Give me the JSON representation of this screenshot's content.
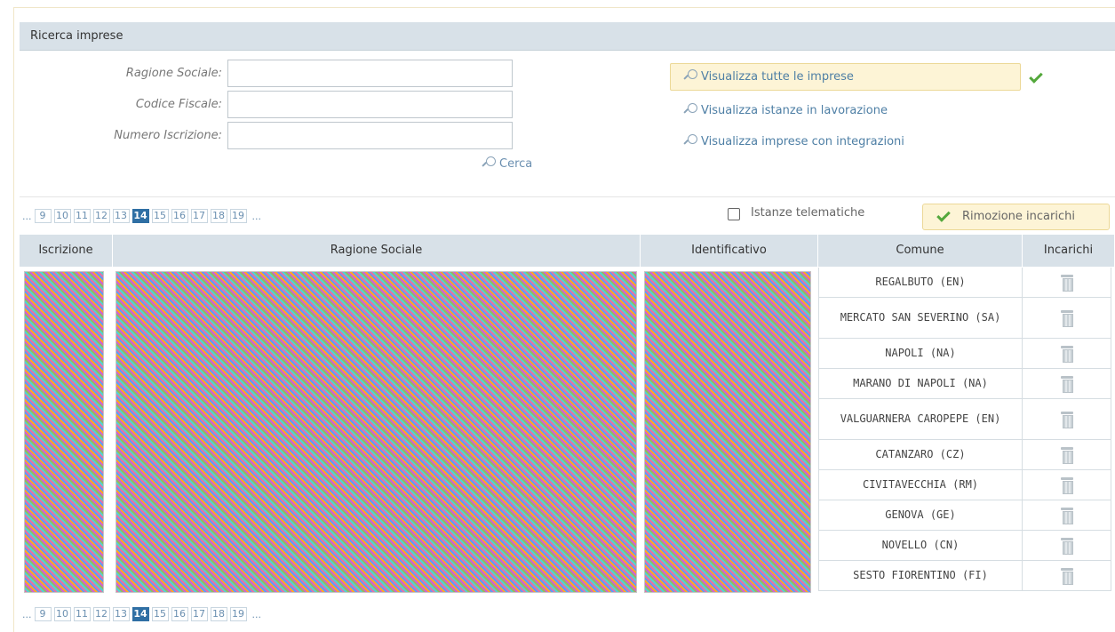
{
  "panel": {
    "title": "Ricerca imprese"
  },
  "form": {
    "ragione_label": "Ragione Sociale:",
    "codice_label": "Codice Fiscale:",
    "numero_label": "Numero Iscrizione:",
    "ragione_value": "",
    "codice_value": "",
    "numero_value": "",
    "search_label": "Cerca"
  },
  "views": {
    "all": "Visualizza tutte le imprese",
    "in_progress": "Visualizza istanze in lavorazione",
    "integrations": "Visualizza imprese con integrazioni"
  },
  "pager": {
    "prefix": "...",
    "suffix": "...",
    "pages": [
      "9",
      "10",
      "11",
      "12",
      "13",
      "14",
      "15",
      "16",
      "17",
      "18",
      "19"
    ],
    "current": "14"
  },
  "toolbar": {
    "telematiche_label": "Istanze telematiche",
    "rimozione_label": "Rimozione incarichi"
  },
  "table": {
    "headers": {
      "iscrizione": "Iscrizione",
      "ragione": "Ragione Sociale",
      "identificativo": "Identificativo",
      "comune": "Comune",
      "incarichi": "Incarichi"
    },
    "rows": [
      {
        "comune": "REGALBUTO (EN)"
      },
      {
        "comune": "MERCATO SAN SEVERINO (SA)"
      },
      {
        "comune": "NAPOLI (NA)"
      },
      {
        "comune": "MARANO DI NAPOLI (NA)"
      },
      {
        "comune": "VALGUARNERA CAROPEPE (EN)"
      },
      {
        "comune": "CATANZARO (CZ)"
      },
      {
        "comune": "CIVITAVECCHIA (RM)"
      },
      {
        "comune": "GENOVA (GE)"
      },
      {
        "comune": "NOVELLO (CN)"
      },
      {
        "comune": "SESTO FIORENTINO (FI)"
      }
    ]
  },
  "colors": {
    "accent": "#2f6fa4",
    "header_bg": "#d8e1e8",
    "highlight_bg": "#fdf4d6",
    "check": "#54a83c"
  }
}
